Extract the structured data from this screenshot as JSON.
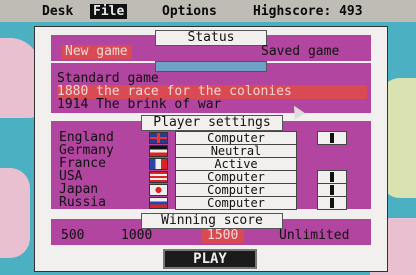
{
  "menu": {
    "items": [
      "Desk",
      "File",
      "Options",
      "Highscore: 493"
    ],
    "selected": "File"
  },
  "status": {
    "title": "Status",
    "new_game": "New game",
    "saved_game": "Saved game"
  },
  "scenario": {
    "header": "",
    "options": [
      "Standard game",
      "1880 the race for the colonies",
      "1914 The brink of war"
    ],
    "selected_index": 1
  },
  "player_settings": {
    "title": "Player settings",
    "players": [
      {
        "country": "England",
        "control": "Computer",
        "flag": "uk"
      },
      {
        "country": "Germany",
        "control": "Neutral",
        "flag": "germany"
      },
      {
        "country": "France",
        "control": "Active",
        "flag": "france"
      },
      {
        "country": "USA",
        "control": "Computer",
        "flag": "usa"
      },
      {
        "country": "Japan",
        "control": "Computer",
        "flag": "japan"
      },
      {
        "country": "Russia",
        "control": "Computer",
        "flag": "russia"
      }
    ]
  },
  "winning_score": {
    "title": "Winning score",
    "options": [
      "500",
      "1000",
      "1500",
      "Unlimited"
    ],
    "selected": "1500"
  },
  "play_label": "PLAY",
  "colors": {
    "panel": "#b2459f",
    "highlight": "#d94a52",
    "background": "#f2f0ee"
  }
}
